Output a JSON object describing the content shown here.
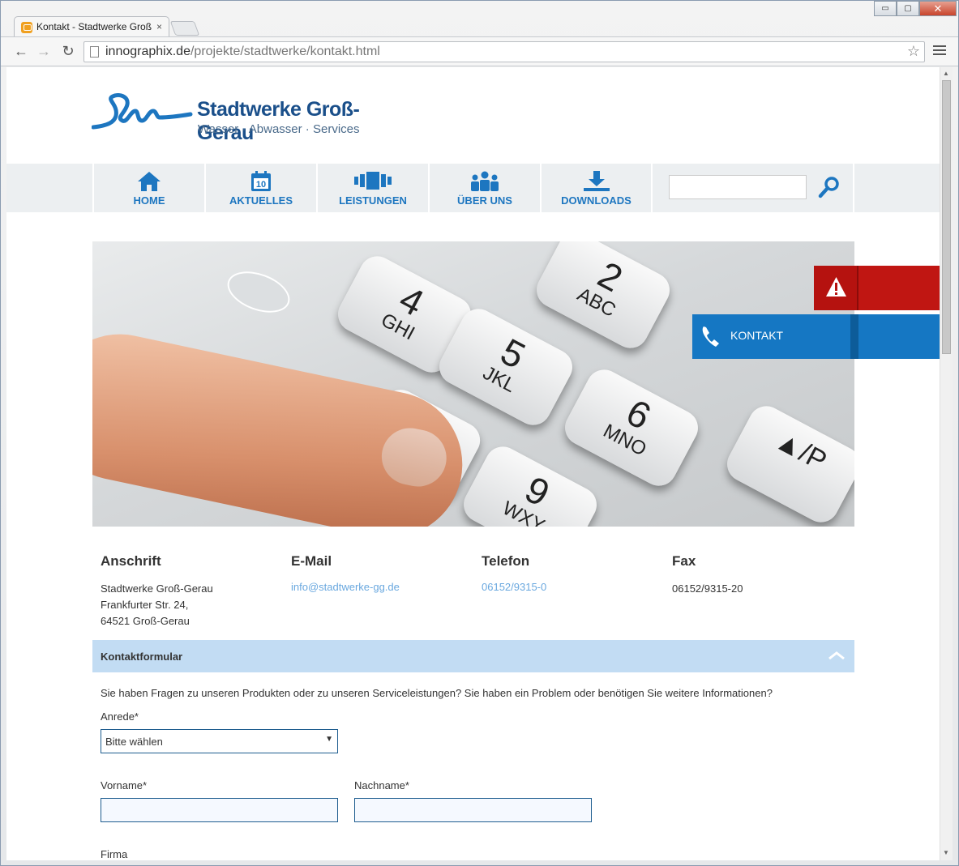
{
  "browser": {
    "tab_title": "Kontakt - Stadtwerke Groß",
    "tab_close": "×",
    "url_domain": "innographix.de",
    "url_path": "/projekte/stadtwerke/kontakt.html",
    "window_buttons": [
      "▭",
      "▢",
      "✕"
    ]
  },
  "logo": {
    "title": "Stadtwerke Groß-Gerau",
    "subtitle": "Wasser · Abwasser · Services",
    "brand_color": "#1a4f8a"
  },
  "nav": {
    "items": [
      {
        "label": "HOME",
        "icon": "home-icon"
      },
      {
        "label": "AKTUELLES",
        "icon": "calendar-icon",
        "calendar_day": "10"
      },
      {
        "label": "LEISTUNGEN",
        "icon": "services-icon"
      },
      {
        "label": "ÜBER UNS",
        "icon": "team-icon"
      },
      {
        "label": "DOWNLOADS",
        "icon": "download-icon"
      }
    ],
    "search_placeholder": "",
    "accent": "#1d76c0"
  },
  "hero": {
    "keys": [
      {
        "num": "4",
        "letters": "GHI"
      },
      {
        "num": "2",
        "letters": "ABC"
      },
      {
        "num": "5",
        "letters": "JKL"
      },
      {
        "num": "6",
        "letters": "MNO"
      },
      {
        "num": "9",
        "letters": "WXY"
      },
      {
        "num": "▲/P",
        "letters": ""
      }
    ]
  },
  "side_tabs": {
    "alert_icon": "warning-icon",
    "kontakt_label": "KONTAKT",
    "kontakt_icon": "phone-icon",
    "alert_color": "#c01612",
    "kontakt_color": "#1577c3"
  },
  "contact": {
    "address": {
      "heading": "Anschrift",
      "line1": "Stadtwerke Groß-Gerau",
      "line2": "Frankfurter Str. 24,",
      "line3": "64521 Groß-Gerau"
    },
    "email": {
      "heading": "E-Mail",
      "value": "info@stadtwerke-gg.de"
    },
    "phone": {
      "heading": "Telefon",
      "value": "06152/9315-0"
    },
    "fax": {
      "heading": "Fax",
      "value": "06152/9315-20"
    }
  },
  "form": {
    "section_title": "Kontaktformular",
    "intro": "Sie haben Fragen zu unseren Produkten oder zu unseren Serviceleistungen? Sie haben ein Problem oder benötigen Sie weitere Informationen?",
    "anrede_label": "Anrede*",
    "anrede_value": "Bitte wählen",
    "vorname_label": "Vorname*",
    "nachname_label": "Nachname*",
    "firma_label": "Firma"
  }
}
